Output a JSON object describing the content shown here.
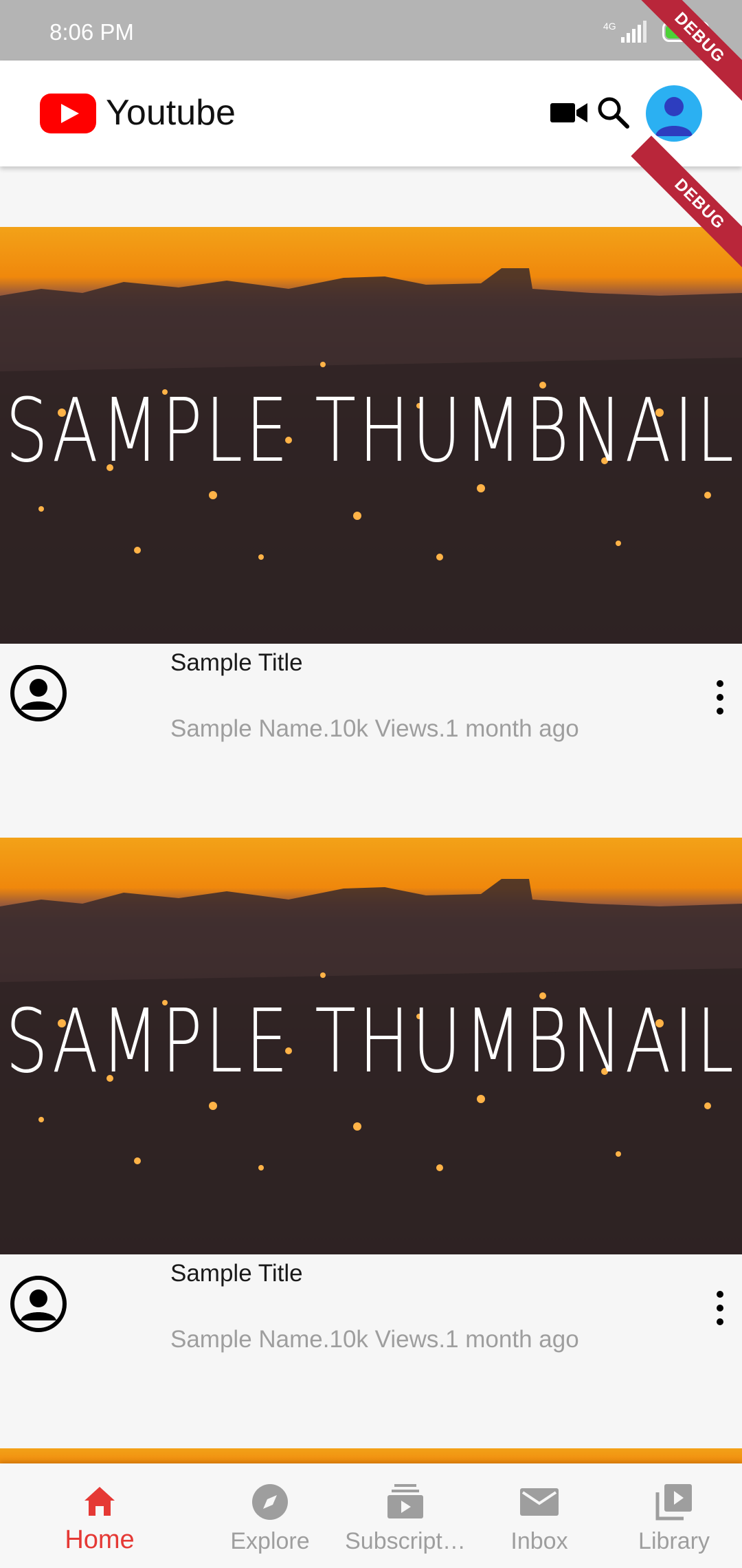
{
  "status_bar": {
    "time": "8:06 PM",
    "network": "4G",
    "battery": "76"
  },
  "debug_banner": "DEBUG",
  "app_bar": {
    "title": "Youtube"
  },
  "videos": [
    {
      "thumbnail_text": "SAMPLE THUMBNAIL",
      "title": "Sample Title",
      "meta": "Sample Name.10k Views.1 month ago"
    },
    {
      "thumbnail_text": "SAMPLE THUMBNAIL",
      "title": "Sample Title",
      "meta": "Sample Name.10k Views.1 month ago"
    }
  ],
  "bottom_nav": {
    "items": [
      {
        "label": "Home",
        "icon": "home-icon",
        "active": true
      },
      {
        "label": "Explore",
        "icon": "compass-icon"
      },
      {
        "label": "Subscript…",
        "icon": "subscriptions-icon"
      },
      {
        "label": "Inbox",
        "icon": "mail-icon"
      },
      {
        "label": "Library",
        "icon": "library-icon"
      }
    ]
  },
  "colors": {
    "brand_red": "#ff0000",
    "active_nav": "#e53935",
    "status_bar": "#b4b4b4",
    "avatar_blue": "#2bb0f2"
  }
}
